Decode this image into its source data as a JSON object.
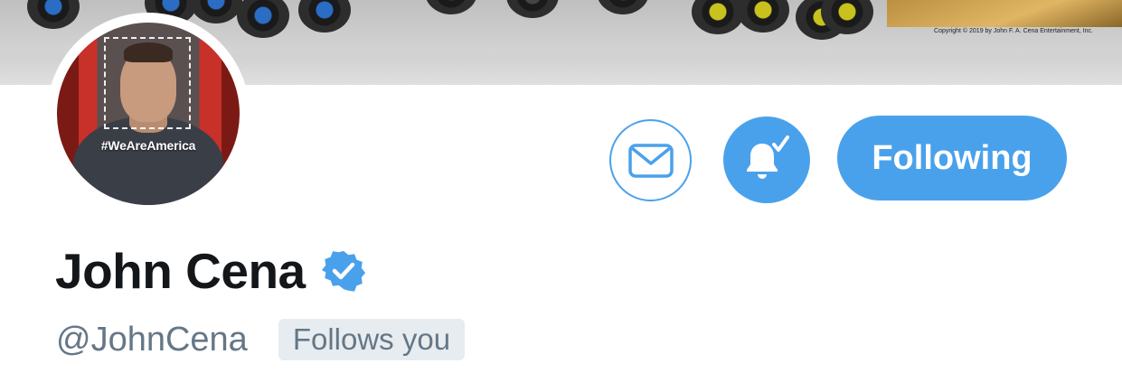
{
  "banner": {
    "copyright": "Copyright © 2019 by John F. A. Cena Entertainment, Inc."
  },
  "avatar": {
    "hashtag": "#WeAreAmerica"
  },
  "actions": {
    "message_icon": "envelope-icon",
    "notifications_icon": "bell-check-icon",
    "follow_label": "Following"
  },
  "profile": {
    "display_name": "John Cena",
    "verified_icon": "verified-badge-icon",
    "handle": "@JohnCena",
    "follows_you": "Follows you"
  },
  "colors": {
    "accent": "#4aa1eb",
    "name_text": "#14171a",
    "secondary_text": "#657786",
    "badge_bg": "#e6ecf0"
  }
}
